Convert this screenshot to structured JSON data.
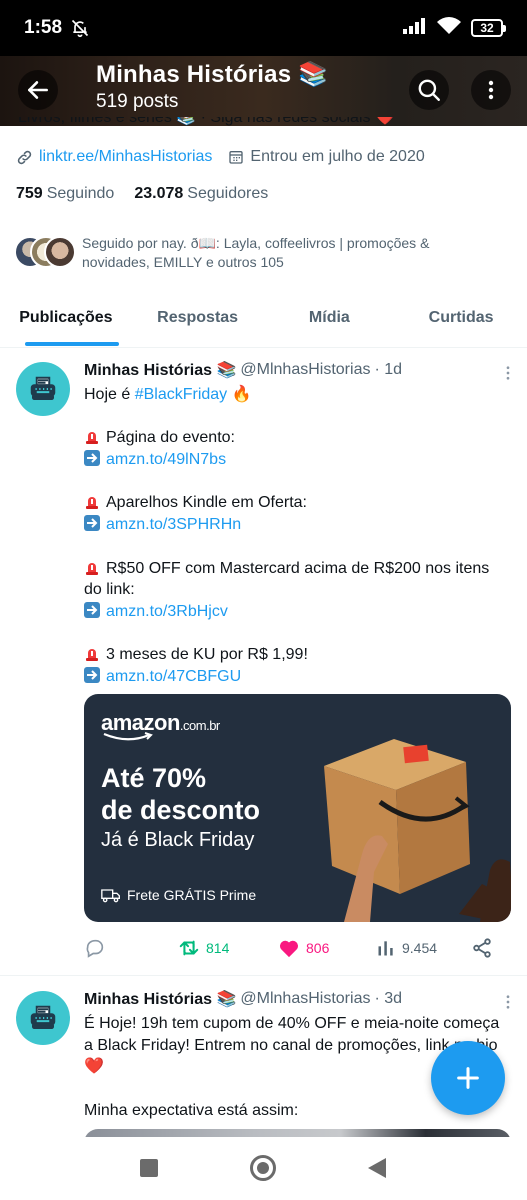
{
  "status_bar": {
    "time": "1:58",
    "battery": "32"
  },
  "header": {
    "title": "Minhas Histórias 📚",
    "subtitle": "519 posts"
  },
  "profile": {
    "bio_cut": "Livros, filmes e séries 📚 · Siga nas redes sociais ❤️",
    "link": "linktr.ee/MinhasHistorias",
    "joined": "Entrou em julho de 2020",
    "following_count": "759",
    "following_label": "Seguindo",
    "followers_count": "23.078",
    "followers_label": "Seguidores",
    "followed_by": "Seguido por nay. ð📖: Layla, coffeelivros | promoções & novidades, EMILLY e outros 105"
  },
  "tabs": [
    {
      "label": "Publicações",
      "active": true
    },
    {
      "label": "Respostas",
      "active": false
    },
    {
      "label": "Mídia",
      "active": false
    },
    {
      "label": "Curtidas",
      "active": false
    }
  ],
  "tweets": [
    {
      "name": "Minhas Histórias 📚",
      "handle": "@MlnhasHistorias",
      "time": "· 1d",
      "l1a": "Hoje é ",
      "l1b": "#BlackFriday",
      "l1c": " 🔥",
      "l2": "Página do evento:",
      "l3": "amzn.to/49lN7bs",
      "l4": "Aparelhos Kindle em Oferta:",
      "l5": "amzn.to/3SPHRHn",
      "l6": "R$50 OFF com Mastercard acima de R$200 nos itens",
      "l7": "do link:",
      "l8": "amzn.to/3RbHjcv",
      "l9": "3 meses de KU por R$ 1,99!",
      "l10": "amzn.to/47CBFGU",
      "media": {
        "logo": "amazon",
        "logo_suffix": ".com.br",
        "headline_1": "Até 70%",
        "headline_2": "de desconto",
        "subhead": "Já é Black Friday",
        "shipping": "Frete GRÁTIS Prime"
      },
      "retweets": "814",
      "likes": "806",
      "views": "9.454"
    },
    {
      "name": "Minhas Histórias 📚",
      "handle": "@MlnhasHistorias",
      "time": "· 3d",
      "l1": "É Hoje! 19h tem cupom de 40% OFF e meia-noite começa",
      "l2": "a Black Friday! Entrem no canal de promoções, link na bio",
      "l3": "❤️",
      "l4": "Minha expectativa está assim:"
    }
  ],
  "colors": {
    "accent": "#1d9bf0",
    "retweet": "#00ba7c",
    "like": "#f91880",
    "amazon_bg": "#232f3e",
    "avatar": "#3ec6cf"
  }
}
